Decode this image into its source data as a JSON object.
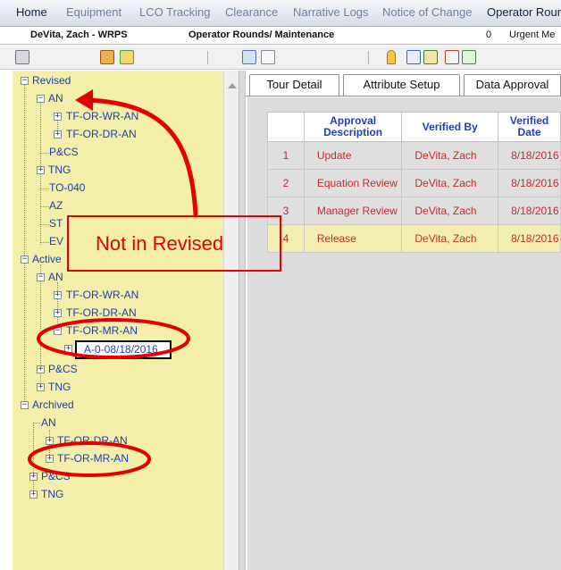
{
  "menu": {
    "items": [
      "Home",
      "Equipment",
      "LCO Tracking",
      "Clearance",
      "Narrative Logs",
      "Notice of Change",
      "Operator Round"
    ]
  },
  "info": {
    "user": "DeVita, Zach - WRPS",
    "module": "Operator Rounds/ Maintenance",
    "count": "0",
    "urgent": "Urgent Me"
  },
  "tree": {
    "revised": "Revised",
    "revised_an": "AN",
    "tf_or_wr_an": "TF-OR-WR-AN",
    "tf_or_dr_an": "TF-OR-DR-AN",
    "pcs": "P&CS",
    "tng": "TNG",
    "to040": "TO-040",
    "az": "AZ",
    "st": "ST",
    "ev": "EV",
    "active": "Active",
    "active_an": "AN",
    "active_wr": "TF-OR-WR-AN",
    "active_dr": "TF-OR-DR-AN",
    "active_mr": "TF-OR-MR-AN",
    "active_item": "A-0-08/18/2016",
    "active_pcs": "P&CS",
    "active_tng": "TNG",
    "archived": "Archived",
    "arch_an": "AN",
    "arch_dr": "TF-OR-DR-AN",
    "arch_mr": "TF-OR-MR-AN",
    "arch_pcs": "P&CS",
    "arch_tng": "TNG"
  },
  "tabs": [
    "Tour Detail",
    "Attribute Setup",
    "Data Approval"
  ],
  "table": {
    "headers": [
      "",
      "Approval Description",
      "Verified By",
      "Verified Date"
    ],
    "rows": [
      [
        "1",
        "Update",
        "DeVita, Zach",
        "8/18/2016"
      ],
      [
        "2",
        "Equation Review",
        "DeVita, Zach",
        "8/18/2016"
      ],
      [
        "3",
        "Manager Review",
        "DeVita, Zach",
        "8/18/2016"
      ],
      [
        "4",
        "Release",
        "DeVita, Zach",
        "8/18/2016"
      ]
    ],
    "selected_row": 4
  },
  "annotation": {
    "callout_text": "Not in Revised",
    "color": "#e60000"
  },
  "icons": [
    "print-icon",
    "user-stamp-icon",
    "user-refresh-icon",
    "calendar-icon",
    "document-icon",
    "key-icon",
    "checklist-icon",
    "export-icon",
    "report-icon",
    "upload-icon"
  ]
}
